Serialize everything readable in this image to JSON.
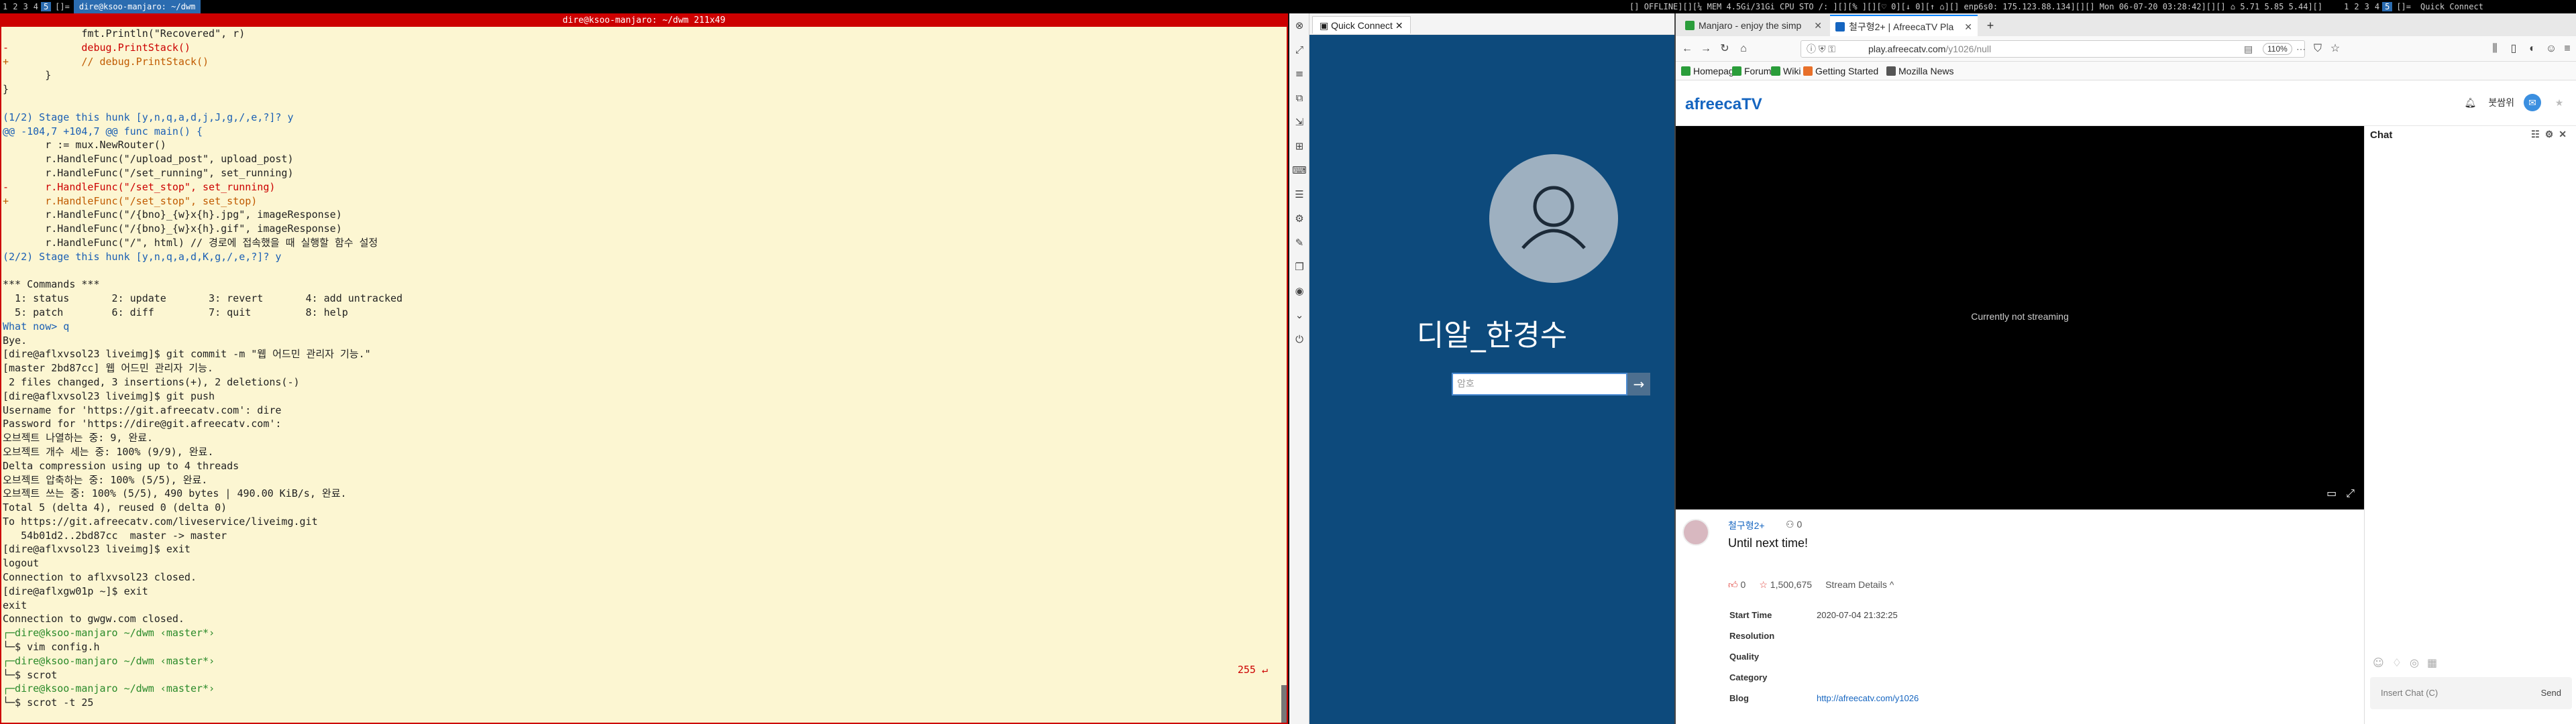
{
  "statusbar": {
    "tags": [
      "1",
      "2",
      "3",
      "4",
      "5"
    ],
    "active_tag": "5",
    "layout": "[]=",
    "window_title": "dire@ksoo-manjaro: ~/dwm",
    "status": "[] OFFLINE][][¼ MEM 4.5Gi/31Gi CPU  STO /: ][][% ][][♡ 0][↓ 0][↑ ⌂][] enp6s0:  175.123.88.134][][] Mon 06-07-20 03:28:42][][] ⌂ 5.71 5.85 5.44][]",
    "tags2": [
      "1",
      "2",
      "3",
      "4",
      "5"
    ],
    "active_tag2": "5",
    "layout2": "[]=",
    "window_title2": "Quick Connect"
  },
  "terminal": {
    "title": "dire@ksoo-manjaro: ~/dwm 211x49",
    "lines": [
      {
        "t": "             fmt.Println(\"Recovered\", r)",
        "c": ""
      },
      {
        "t": "-            debug.PrintStack()",
        "c": "c-red"
      },
      {
        "t": "+            // debug.PrintStack()",
        "c": "c-orange"
      },
      {
        "t": "       }",
        "c": ""
      },
      {
        "t": "}",
        "c": ""
      },
      {
        "t": "",
        "c": ""
      },
      {
        "t": "(1/2) Stage this hunk [y,n,q,a,d,j,J,g,/,e,?]? y",
        "c": "c-blue"
      },
      {
        "t": "@@ -104,7 +104,7 @@ func main() {",
        "c": "c-blue"
      },
      {
        "t": "       r := mux.NewRouter()",
        "c": ""
      },
      {
        "t": "       r.HandleFunc(\"/upload_post\", upload_post)",
        "c": ""
      },
      {
        "t": "       r.HandleFunc(\"/set_running\", set_running)",
        "c": ""
      },
      {
        "t": "-      r.HandleFunc(\"/set_stop\", set_running)",
        "c": "c-red"
      },
      {
        "t": "+      r.HandleFunc(\"/set_stop\", set_stop)",
        "c": "c-orange"
      },
      {
        "t": "       r.HandleFunc(\"/{bno}_{w}x{h}.jpg\", imageResponse)",
        "c": ""
      },
      {
        "t": "       r.HandleFunc(\"/{bno}_{w}x{h}.gif\", imageResponse)",
        "c": ""
      },
      {
        "t": "       r.HandleFunc(\"/\", html) // 경로에 접속했을 때 실행할 함수 설정",
        "c": ""
      },
      {
        "t": "(2/2) Stage this hunk [y,n,q,a,d,K,g,/,e,?]? y",
        "c": "c-blue"
      },
      {
        "t": "",
        "c": ""
      },
      {
        "t": "*** Commands ***",
        "c": ""
      },
      {
        "t": "  1: status       2: update       3: revert       4: add untracked",
        "c": ""
      },
      {
        "t": "  5: patch        6: diff         7: quit         8: help",
        "c": ""
      },
      {
        "t": "What now> q",
        "c": "c-blue"
      },
      {
        "t": "Bye.",
        "c": ""
      },
      {
        "t": "[dire@aflxvsol23 liveimg]$ git commit -m \"웹 어드민 관리자 기능.\"",
        "c": ""
      },
      {
        "t": "[master 2bd87cc] 웹 어드민 관리자 기능.",
        "c": ""
      },
      {
        "t": " 2 files changed, 3 insertions(+), 2 deletions(-)",
        "c": ""
      },
      {
        "t": "[dire@aflxvsol23 liveimg]$ git push",
        "c": ""
      },
      {
        "t": "Username for 'https://git.afreecatv.com': dire",
        "c": ""
      },
      {
        "t": "Password for 'https://dire@git.afreecatv.com':",
        "c": ""
      },
      {
        "t": "오브젝트 나열하는 중: 9, 완료.",
        "c": ""
      },
      {
        "t": "오브젝트 개수 세는 중: 100% (9/9), 완료.",
        "c": ""
      },
      {
        "t": "Delta compression using up to 4 threads",
        "c": ""
      },
      {
        "t": "오브젝트 압축하는 중: 100% (5/5), 완료.",
        "c": ""
      },
      {
        "t": "오브젝트 쓰는 중: 100% (5/5), 490 bytes | 490.00 KiB/s, 완료.",
        "c": ""
      },
      {
        "t": "Total 5 (delta 4), reused 0 (delta 0)",
        "c": ""
      },
      {
        "t": "To https://git.afreecatv.com/liveservice/liveimg.git",
        "c": ""
      },
      {
        "t": "   54b01d2..2bd87cc  master -> master",
        "c": ""
      },
      {
        "t": "[dire@aflxvsol23 liveimg]$ exit",
        "c": ""
      },
      {
        "t": "logout",
        "c": ""
      },
      {
        "t": "Connection to aflxvsol23 closed.",
        "c": ""
      },
      {
        "t": "[dire@aflxgw01p ~]$ exit",
        "c": ""
      },
      {
        "t": "exit",
        "c": ""
      },
      {
        "t": "Connection to gwgw.com closed.",
        "c": ""
      },
      {
        "t": "┌─dire@ksoo-manjaro ~/dwm ‹master*›",
        "c": "c-green"
      },
      {
        "t": "└─$ vim config.h",
        "c": ""
      },
      {
        "t": "┌─dire@ksoo-manjaro ~/dwm ‹master*›",
        "c": "c-green"
      },
      {
        "t": "└─$ scrot",
        "c": ""
      },
      {
        "t": "┌─dire@ksoo-manjaro ~/dwm ‹master*›",
        "c": "c-green"
      },
      {
        "t": "└─$ scrot -t 25",
        "c": ""
      }
    ],
    "exit_code": "255 ↵"
  },
  "quickconnect": {
    "tab_label": "Quick Connect",
    "user_name": "디알_한경수",
    "password_placeholder": "암호"
  },
  "firefox": {
    "tabs": [
      {
        "label": "Manjaro - enjoy the simp",
        "color": "#2a9d3a"
      },
      {
        "label": "철구형2+ | AfreecaTV Pla",
        "color": "#1565c0"
      }
    ],
    "url_host": "play.afreecatv.com",
    "url_path": "/y1026/null",
    "zoom": "110%",
    "bookmarks": [
      {
        "label": "Homepage",
        "color": "#2a9d3a"
      },
      {
        "label": "Forum",
        "color": "#2a9d3a"
      },
      {
        "label": "Wiki",
        "color": "#2a9d3a"
      },
      {
        "label": "Getting Started",
        "color": "#e8702a"
      },
      {
        "label": "Mozilla News",
        "color": "#555"
      }
    ]
  },
  "afreeca": {
    "logo": "afreecaTV",
    "header_user": "붓쌈위",
    "player_message": "Currently not streaming",
    "bj_name": "철구형2+",
    "fans": "0",
    "broadcast_title": "Until next time!",
    "likes": "0",
    "favorites": "1,500,675",
    "stream_details": "Stream Details ^",
    "details": [
      {
        "label": "Start Time",
        "value": "2020-07-04 21:32:25",
        "link": false
      },
      {
        "label": "Resolution",
        "value": "",
        "link": false
      },
      {
        "label": "Quality",
        "value": "",
        "link": false
      },
      {
        "label": "Category",
        "value": "",
        "link": false
      },
      {
        "label": "Blog",
        "value": "http://afreecatv.com/y1026",
        "link": true
      }
    ],
    "chat_title": "Chat",
    "chat_placeholder": "Insert Chat (C)",
    "chat_send": "Send"
  }
}
